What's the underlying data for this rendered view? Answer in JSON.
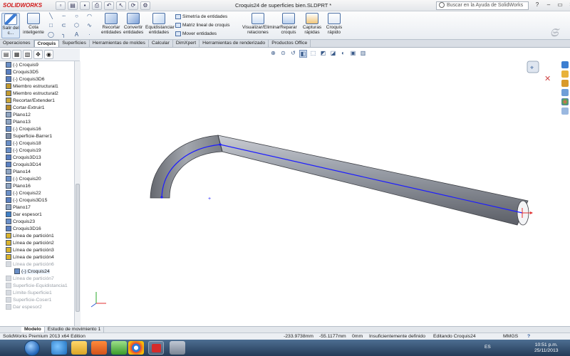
{
  "app": {
    "logo": "SOLIDWORKS",
    "title": "Croquis24 de superficies bien.SLDPRT *"
  },
  "search": {
    "placeholder": "Buscar en la Ayuda de SolidWorks"
  },
  "ribbon": {
    "salir": "Salir del c...",
    "cota": "Cota inteligente",
    "recortar": "Recortar entidades",
    "convertir": "Convertir entidades",
    "equidistanciar": "Equidistanciar entidades",
    "simetria": "Simetría de entidades",
    "matriz": "Matriz lineal de croquis",
    "mover": "Mover entidades",
    "visualizar": "Visualizar/Eliminar relaciones",
    "reparar": "Reparar croquis",
    "capturas": "Capturas rápidas",
    "croquis_rapido": "Croquis rápido"
  },
  "tabs": [
    "Operaciones",
    "Croquis",
    "Superficies",
    "Herramientas de moldes",
    "Calcular",
    "DimXpert",
    "Herramientas de renderizado",
    "Productos Office"
  ],
  "active_tab": "Croquis",
  "tree": [
    {
      "label": "(-) Croquis9",
      "icon": "sketch-icon",
      "state": "normal"
    },
    {
      "label": "Croquis3D5",
      "icon": "sketch3d-icon",
      "state": "normal"
    },
    {
      "label": "(-) Croquis3D6",
      "icon": "sketch3d-icon",
      "state": "normal"
    },
    {
      "label": "Miembro estructural1",
      "icon": "weldment-icon",
      "state": "normal"
    },
    {
      "label": "Miembro estructural2",
      "icon": "weldment-icon",
      "state": "normal"
    },
    {
      "label": "Recortar/Extender1",
      "icon": "trim-icon",
      "state": "normal"
    },
    {
      "label": "Cortar-Extruir1",
      "icon": "cut-icon",
      "state": "normal"
    },
    {
      "label": "Plano12",
      "icon": "plane-icon",
      "state": "normal"
    },
    {
      "label": "Plano13",
      "icon": "plane-icon",
      "state": "normal"
    },
    {
      "label": "(-) Croquis16",
      "icon": "sketch-icon",
      "state": "normal"
    },
    {
      "label": "Superficie-Barrer1",
      "icon": "surface-icon",
      "state": "normal"
    },
    {
      "label": "(-) Croquis18",
      "icon": "sketch-icon",
      "state": "normal"
    },
    {
      "label": "(-) Croquis19",
      "icon": "sketch-icon",
      "state": "normal"
    },
    {
      "label": "Croquis3D13",
      "icon": "sketch3d-icon",
      "state": "normal"
    },
    {
      "label": "Croquis3D14",
      "icon": "sketch3d-icon",
      "state": "normal"
    },
    {
      "label": "Plano14",
      "icon": "plane-icon",
      "state": "normal"
    },
    {
      "label": "(-) Croquis20",
      "icon": "sketch-icon",
      "state": "normal"
    },
    {
      "label": "Plano16",
      "icon": "plane-icon",
      "state": "normal"
    },
    {
      "label": "(-) Croquis22",
      "icon": "sketch-icon",
      "state": "normal"
    },
    {
      "label": "(-) Croquis3D15",
      "icon": "sketch3d-icon",
      "state": "normal"
    },
    {
      "label": "Plano17",
      "icon": "plane-icon",
      "state": "normal"
    },
    {
      "label": "Dar espesor1",
      "icon": "thicken-icon",
      "state": "normal"
    },
    {
      "label": "Croquis23",
      "icon": "sketch-icon",
      "state": "normal"
    },
    {
      "label": "Croquis3D16",
      "icon": "sketch3d-icon",
      "state": "normal"
    },
    {
      "label": "Línea de partición1",
      "icon": "split-line-icon",
      "state": "normal"
    },
    {
      "label": "Línea de partición2",
      "icon": "split-line-icon",
      "state": "normal"
    },
    {
      "label": "Línea de partición3",
      "icon": "split-line-icon",
      "state": "normal"
    },
    {
      "label": "Línea de partición4",
      "icon": "split-line-icon",
      "state": "normal"
    },
    {
      "label": "Línea de partición6",
      "icon": "split-line-icon",
      "state": "dim"
    },
    {
      "label": "(-) Croquis24",
      "icon": "sketch-icon",
      "state": "active"
    },
    {
      "label": "Línea de partición7",
      "icon": "split-line-icon",
      "state": "dim"
    },
    {
      "label": "Superficie-Equidistancia1",
      "icon": "surface-icon",
      "state": "dim"
    },
    {
      "label": "Límite-Superficie1",
      "icon": "surface-icon",
      "state": "dim"
    },
    {
      "label": "Superficie-Coser1",
      "icon": "surface-icon",
      "state": "dim"
    },
    {
      "label": "Dar espesor2",
      "icon": "thicken-icon",
      "state": "dim"
    }
  ],
  "bottom_tabs": [
    "Modelo",
    "Estudio de movimiento 1"
  ],
  "status": {
    "edition": "SolidWorks Premium 2013 x64 Edition",
    "x": "-233.9738mm",
    "y": "-55.1177mm",
    "z": "0mm",
    "definition": "Insuficientemente definido",
    "editing": "Editando Croquis24",
    "units": "MMGS",
    "help": "?"
  },
  "taskbar": {
    "lang": "ES",
    "time": "10:51 p.m.",
    "date": "25/11/2013"
  },
  "colors": {
    "accent": "#2b579a",
    "sketch_line": "#1d1dff",
    "origin_red": "#e03030",
    "tube_dark": "#5b5e66",
    "tube_light": "#c9ccd3"
  }
}
